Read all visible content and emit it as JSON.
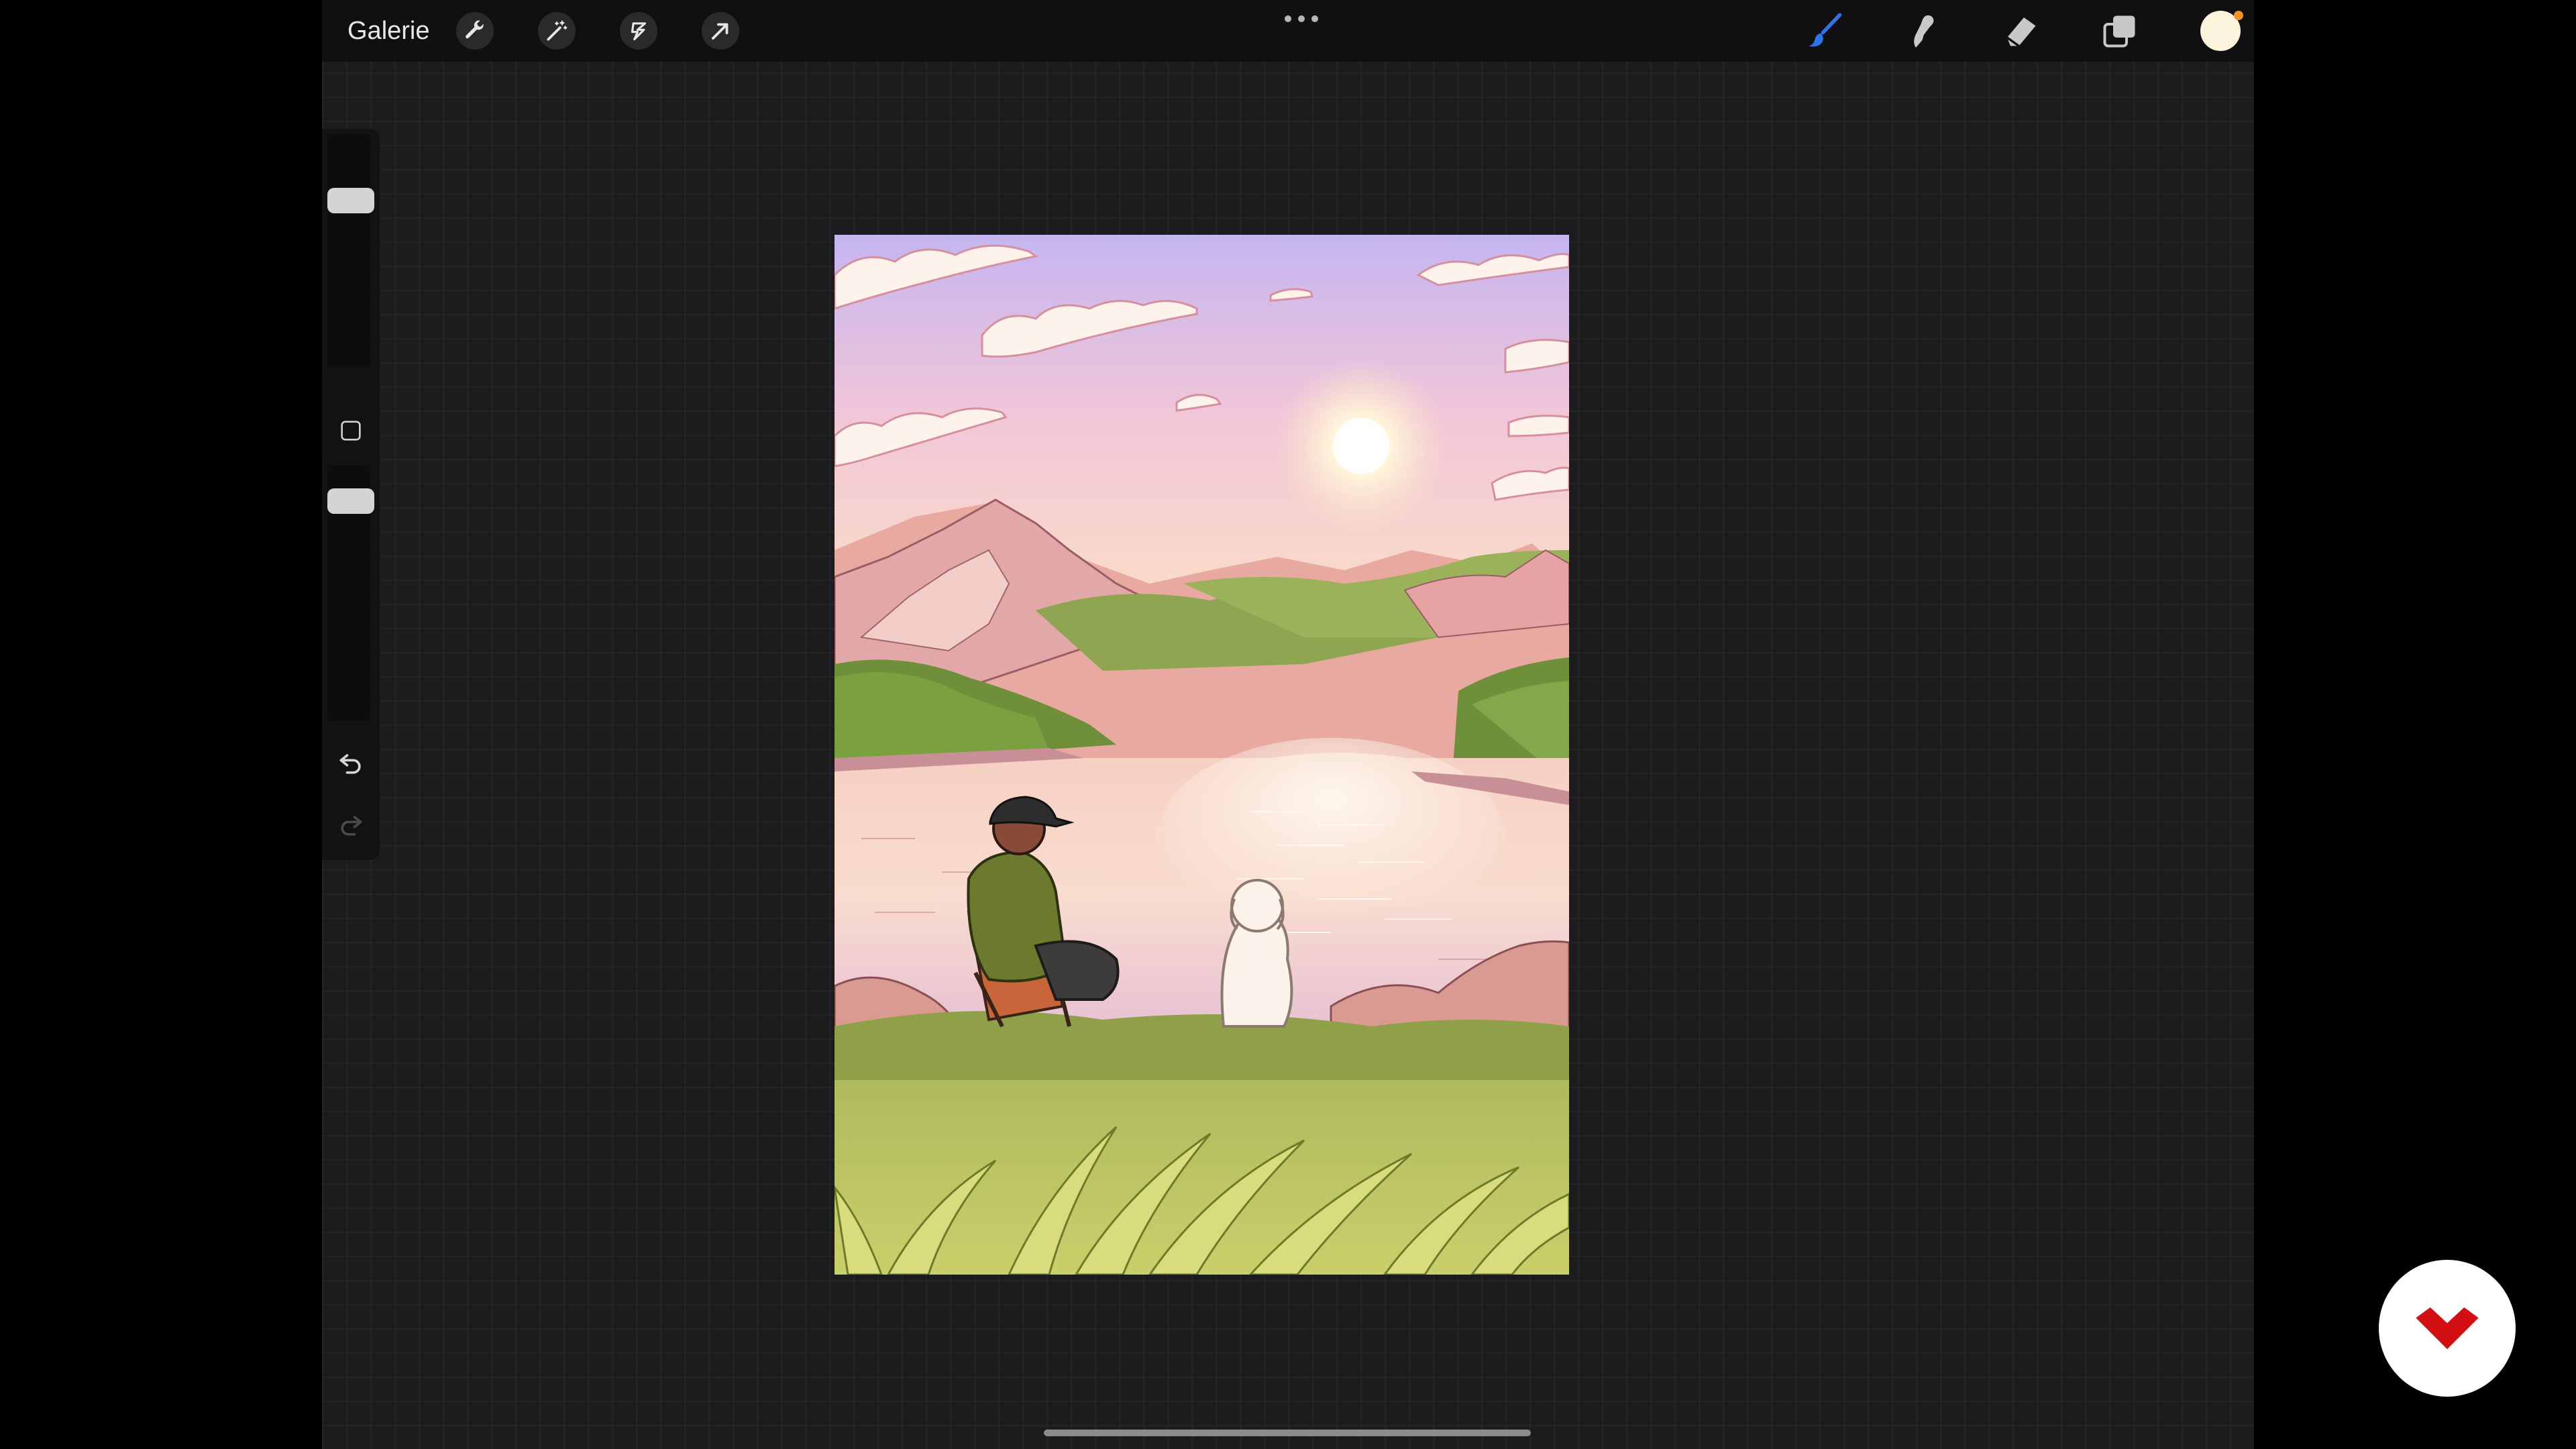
{
  "topbar": {
    "gallery_label": "Galerie",
    "left_tools": [
      {
        "icon": "wrench-icon",
        "name": "actions"
      },
      {
        "icon": "magic-wand-icon",
        "name": "adjustments"
      },
      {
        "icon": "selection-icon",
        "name": "selection"
      },
      {
        "icon": "arrow-cursor-icon",
        "name": "transform"
      }
    ],
    "more_icon": "ellipsis-icon",
    "right_tools": [
      {
        "icon": "brush-icon",
        "name": "paint",
        "active": true
      },
      {
        "icon": "smudge-icon",
        "name": "smudge"
      },
      {
        "icon": "eraser-icon",
        "name": "erase"
      },
      {
        "icon": "layers-icon",
        "name": "layers"
      }
    ],
    "current_color": "#fbf3dc"
  },
  "sidebar": {
    "brush_size_icon": "slider-handle",
    "modify_icon": "square-icon",
    "opacity_icon": "slider-handle",
    "undo_icon": "undo-icon",
    "redo_icon": "redo-icon"
  },
  "canvas": {
    "subject": "artwork-lake-sunset"
  },
  "colors": {
    "accent_blue": "#2f74e6",
    "brand_red": "#d40f14",
    "background": "#1c1c1e"
  },
  "brand": {
    "logo": "domestika-logo"
  }
}
